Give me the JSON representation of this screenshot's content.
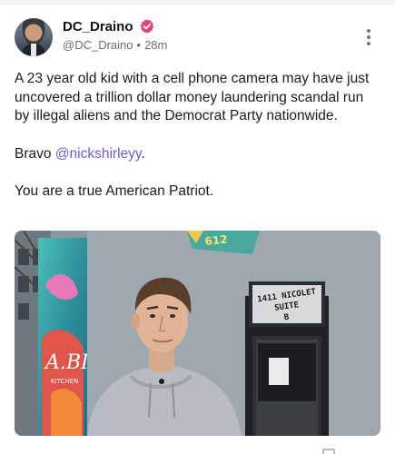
{
  "post": {
    "author": {
      "display_name": "DC_Draino",
      "handle": "@DC_Draino",
      "separator": "•",
      "time": "28m",
      "verified_color": "#e2457a"
    },
    "text": {
      "paragraph1": "A 23 year old kid with a cell phone camera may have just uncovered a trillion dollar money laundering scandal run by illegal aliens and the Democrat Party nationwide.",
      "paragraph2_prefix": "Bravo ",
      "paragraph2_mention": "@nickshirleyy",
      "paragraph2_suffix": ".",
      "paragraph3": "You are a true American Patriot."
    },
    "media": {
      "sign_text": "1411 NICOLET SUITE B",
      "sign_line1": "1411 NICOLET",
      "sign_line2": "SUITE",
      "sign_line3": "B",
      "mural_text": "A.BI",
      "mural_subtext": "KITCHEN",
      "upper_sign": "612"
    },
    "colors": {
      "mention": "#6a5bd6",
      "muted": "#6b6b76"
    }
  }
}
